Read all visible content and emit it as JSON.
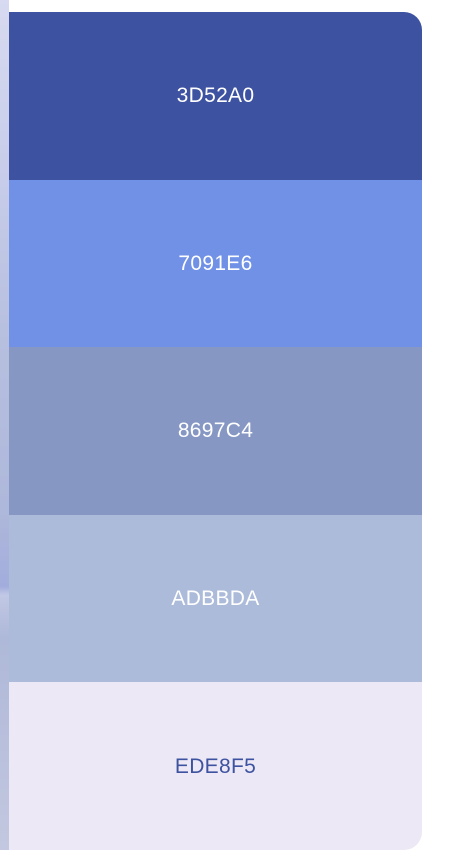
{
  "palette": {
    "swatches": [
      {
        "hex": "3D52A0",
        "color": "#3D52A0",
        "text_color": "#ffffff"
      },
      {
        "hex": "7091E6",
        "color": "#7091E6",
        "text_color": "#ffffff"
      },
      {
        "hex": "8697C4",
        "color": "#8697C4",
        "text_color": "#ffffff"
      },
      {
        "hex": "ADBBDA",
        "color": "#ADBBDA",
        "text_color": "#ffffff"
      },
      {
        "hex": "EDE8F5",
        "color": "#EDE8F5",
        "text_color": "#3D52A0"
      }
    ]
  }
}
